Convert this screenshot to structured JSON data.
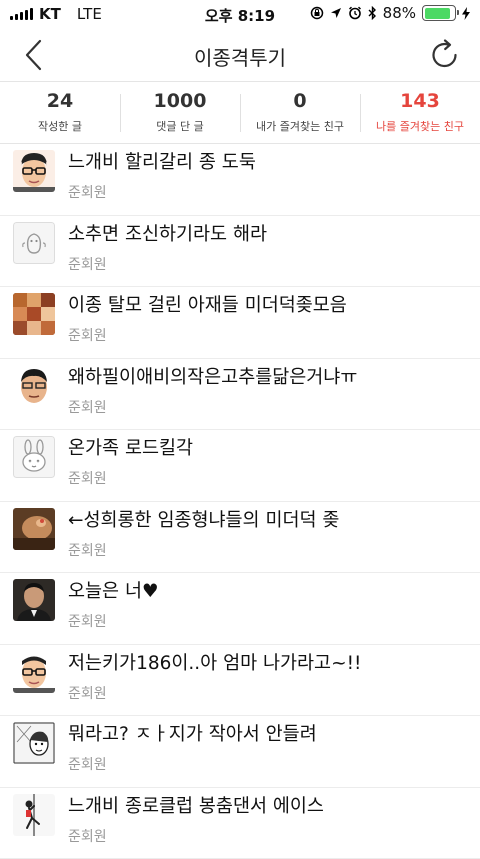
{
  "status_bar": {
    "carrier": "KT",
    "network": "LTE",
    "time": "오후 8:19",
    "battery_text": "88%",
    "battery_level": 0.88,
    "icons": [
      "rotation-lock-icon",
      "location-icon",
      "alarm-icon",
      "bluetooth-icon",
      "charging-icon"
    ]
  },
  "nav": {
    "title": "이종격투기",
    "back_icon": "chevron-left-icon",
    "refresh_icon": "refresh-icon"
  },
  "stats": [
    {
      "count": "24",
      "label": "작성한 글",
      "active": false
    },
    {
      "count": "1000",
      "label": "댓글 단 글",
      "active": false
    },
    {
      "count": "0",
      "label": "내가 즐겨찾는 친구",
      "active": false
    },
    {
      "count": "143",
      "label": "나를 즐겨찾는 친구",
      "active": true
    }
  ],
  "colors": {
    "accent": "#e5453d",
    "battery": "#4cd964"
  },
  "posts": [
    {
      "title": "느개비 할리갈리 종 도둑",
      "author": "준회원",
      "thumb": "glasses-man"
    },
    {
      "title": "소추면 조신하기라도 해라",
      "author": "준회원",
      "thumb": "default-avatar"
    },
    {
      "title": "이종 탈모 걸린 아재들 미더덕좆모음",
      "author": "준회원",
      "thumb": "photo-collage"
    },
    {
      "title": "왜하필이애비의작은고추를닮은거냐ㅠ",
      "author": "준회원",
      "thumb": "man-portrait"
    },
    {
      "title": "온가족 로드킬각",
      "author": "준회원",
      "thumb": "bunny-avatar"
    },
    {
      "title": "←성희롱한 임종형냐들의 미더덕 좆",
      "author": "준회원",
      "thumb": "photo-closeup"
    },
    {
      "title": "오늘은 너♥",
      "author": "준회원",
      "thumb": "man-suit"
    },
    {
      "title": "저는키가186이..아 엄마 나가라고~!!",
      "author": "준회원",
      "thumb": "glasses-man"
    },
    {
      "title": "뭐라고? ㅈㅏ지가 작아서 안들려",
      "author": "준회원",
      "thumb": "comic"
    },
    {
      "title": "느개비 종로클럽 봉춤댄서 에이스",
      "author": "준회원",
      "thumb": "dancer"
    }
  ]
}
